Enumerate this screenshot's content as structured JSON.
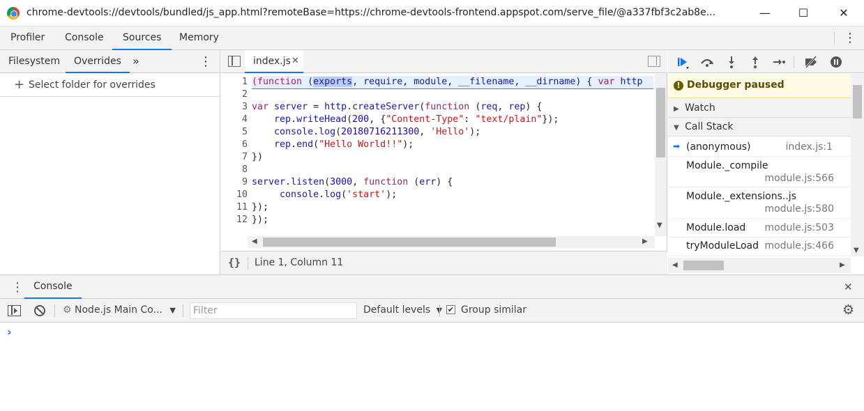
{
  "window": {
    "title": "chrome-devtools://devtools/bundled/js_app.html?remoteBase=https://chrome-devtools-frontend.appspot.com/serve_file/@a337fbf3c2ab8e...",
    "minimize": "—",
    "maximize": "☐",
    "close": "✕"
  },
  "main_tabs": [
    "Profiler",
    "Console",
    "Sources",
    "Memory"
  ],
  "main_tabs_active": "Sources",
  "navigator": {
    "tabs": [
      "Filesystem",
      "Overrides"
    ],
    "more": "»",
    "menu": "⋮",
    "add_folder": "Select folder for overrides",
    "add_icon": "+"
  },
  "editor": {
    "file_tab": "index.js",
    "close_tab": "✕",
    "line_numbers": [
      "1",
      "2",
      "3",
      "4",
      "5",
      "6",
      "7",
      "8",
      "9",
      "10",
      "11",
      "12"
    ],
    "status": "Line 1, Column 11",
    "format_icon": "{}"
  },
  "debugger": {
    "paused_text": "Debugger paused",
    "watch": "Watch",
    "call_stack": "Call Stack",
    "frames": [
      {
        "name": "(anonymous)",
        "location": "index.js:1",
        "current": true
      },
      {
        "name": "Module._compile",
        "location": "module.js:566",
        "current": false
      },
      {
        "name": "Module._extensions..js",
        "location": "module.js:580",
        "current": false
      },
      {
        "name": "Module.load",
        "location": "module.js:503",
        "current": false
      },
      {
        "name": "tryModuleLoad",
        "location": "module.js:466",
        "current": false
      }
    ]
  },
  "drawer": {
    "tab": "Console",
    "close": "✕",
    "menu": "⋮",
    "context": "Node.js Main Co...",
    "filter_placeholder": "Filter",
    "levels": "Default levels",
    "group_similar": "Group similar",
    "prompt": "›"
  }
}
